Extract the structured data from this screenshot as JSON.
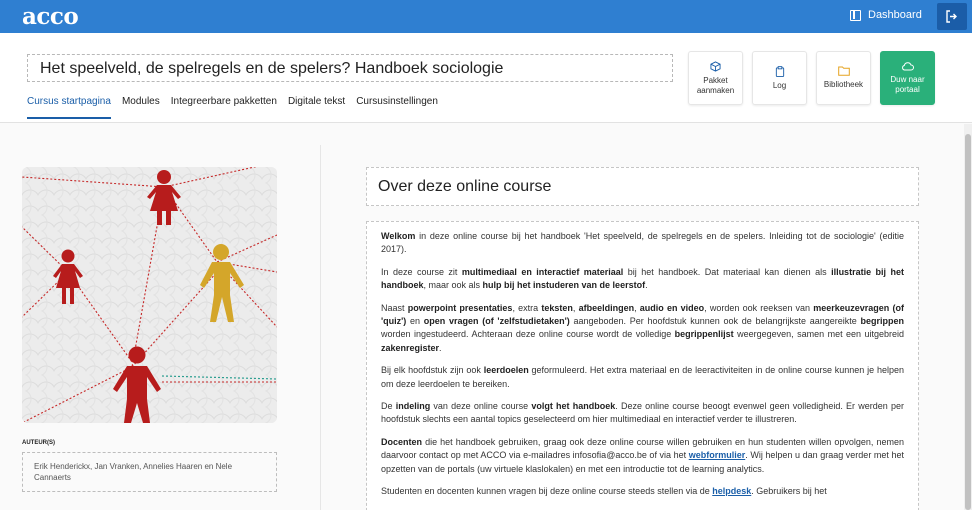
{
  "app": {
    "logo": "acco",
    "dashboard_label": "Dashboard",
    "brand_color": "#2f7fd1",
    "accent_green": "#2ab07a"
  },
  "course": {
    "title": "Het speelveld, de spelregels en de spelers? Handboek sociologie"
  },
  "tabs": [
    {
      "label": "Cursus startpagina",
      "active": true
    },
    {
      "label": "Modules",
      "active": false
    },
    {
      "label": "Integreerbare pakketten",
      "active": false
    },
    {
      "label": "Digitale tekst",
      "active": false
    },
    {
      "label": "Cursusinstellingen",
      "active": false
    }
  ],
  "actions": [
    {
      "label_1": "Pakket",
      "label_2": "aanmaken",
      "icon": "package-icon"
    },
    {
      "label_1": "Log",
      "label_2": "",
      "icon": "clipboard-icon"
    },
    {
      "label_1": "Bibliotheek",
      "label_2": "",
      "icon": "folder-icon"
    },
    {
      "label_1": "Duw naar",
      "label_2": "portaal",
      "icon": "cloud-icon"
    }
  ],
  "sidebar": {
    "author_label": "AUTEUR(S)",
    "authors": "Erik Henderickx, Jan Vranken, Annelies Haaren en Nele Cannaerts"
  },
  "main": {
    "about_title": "Over deze online course",
    "p1": {
      "b1": "Welkom",
      "t1": " in deze online course bij het handboek 'Het speelveld, de spelregels en de spelers. Inleiding tot de sociologie' (editie 2017)."
    },
    "p2": {
      "t1": "In deze course zit ",
      "b1": "multimediaal en interactief materiaal",
      "t2": " bij het handboek. Dat materiaal kan dienen als ",
      "b2": "illustratie bij het handboek",
      "t3": ", maar ook als ",
      "b3": "hulp bij het instuderen van de leerstof",
      "t4": "."
    },
    "p3": {
      "t1": "Naast ",
      "b1": "powerpoint presentaties",
      "t2": ", extra ",
      "b2": "teksten",
      "t3": ", ",
      "b3": "afbeeldingen",
      "t4": ", ",
      "b4": "audio en video",
      "t5": ", worden ook reeksen van ",
      "b5": "meerkeuzevragen (of 'quiz')",
      "t6": " en ",
      "b6": "open vragen (of 'zelfstudietaken')",
      "t7": " aangeboden. Per hoofdstuk kunnen ook de belangrijkste aangereikte ",
      "b7": "begrippen",
      "t8": " worden ingestudeerd. Achteraan deze online course wordt de volledige ",
      "b8": "begrippenlijst",
      "t9": " weergegeven, samen met een uitgebreid ",
      "b9": "zakenregister",
      "t10": "."
    },
    "p4": {
      "t1": "Bij elk hoofdstuk zijn ook ",
      "b1": "leerdoelen",
      "t2": " geformuleerd. Het extra materiaal en de leeractiviteiten in de online course kunnen je helpen om deze leerdoelen te bereiken."
    },
    "p5": {
      "t1": "De ",
      "b1": "indeling",
      "t2": " van deze online course ",
      "b2": "volgt het handboek",
      "t3": ". Deze online course beoogt evenwel geen volledigheid. Er werden per hoofdstuk slechts een aantal topics geselecteerd om hier multimediaal en interactief verder te illustreren."
    },
    "p6": {
      "b1": "Docenten",
      "t1": " die het handboek gebruiken, graag ook deze online course willen gebruiken en hun studenten willen opvolgen, nemen daarvoor contact op met ACCO via e-mailadres infosofia@acco.be of via het ",
      "link": "webformulier",
      "t2": ". Wij helpen u dan graag verder met het opzetten van de portals (uw virtuele klaslokalen) en met een introductie tot de learning analytics."
    },
    "p7": {
      "t1": "Studenten en docenten kunnen vragen bij deze online course steeds stellen via de ",
      "link": "helpdesk",
      "t2": ". Gebruikers bij het"
    }
  }
}
